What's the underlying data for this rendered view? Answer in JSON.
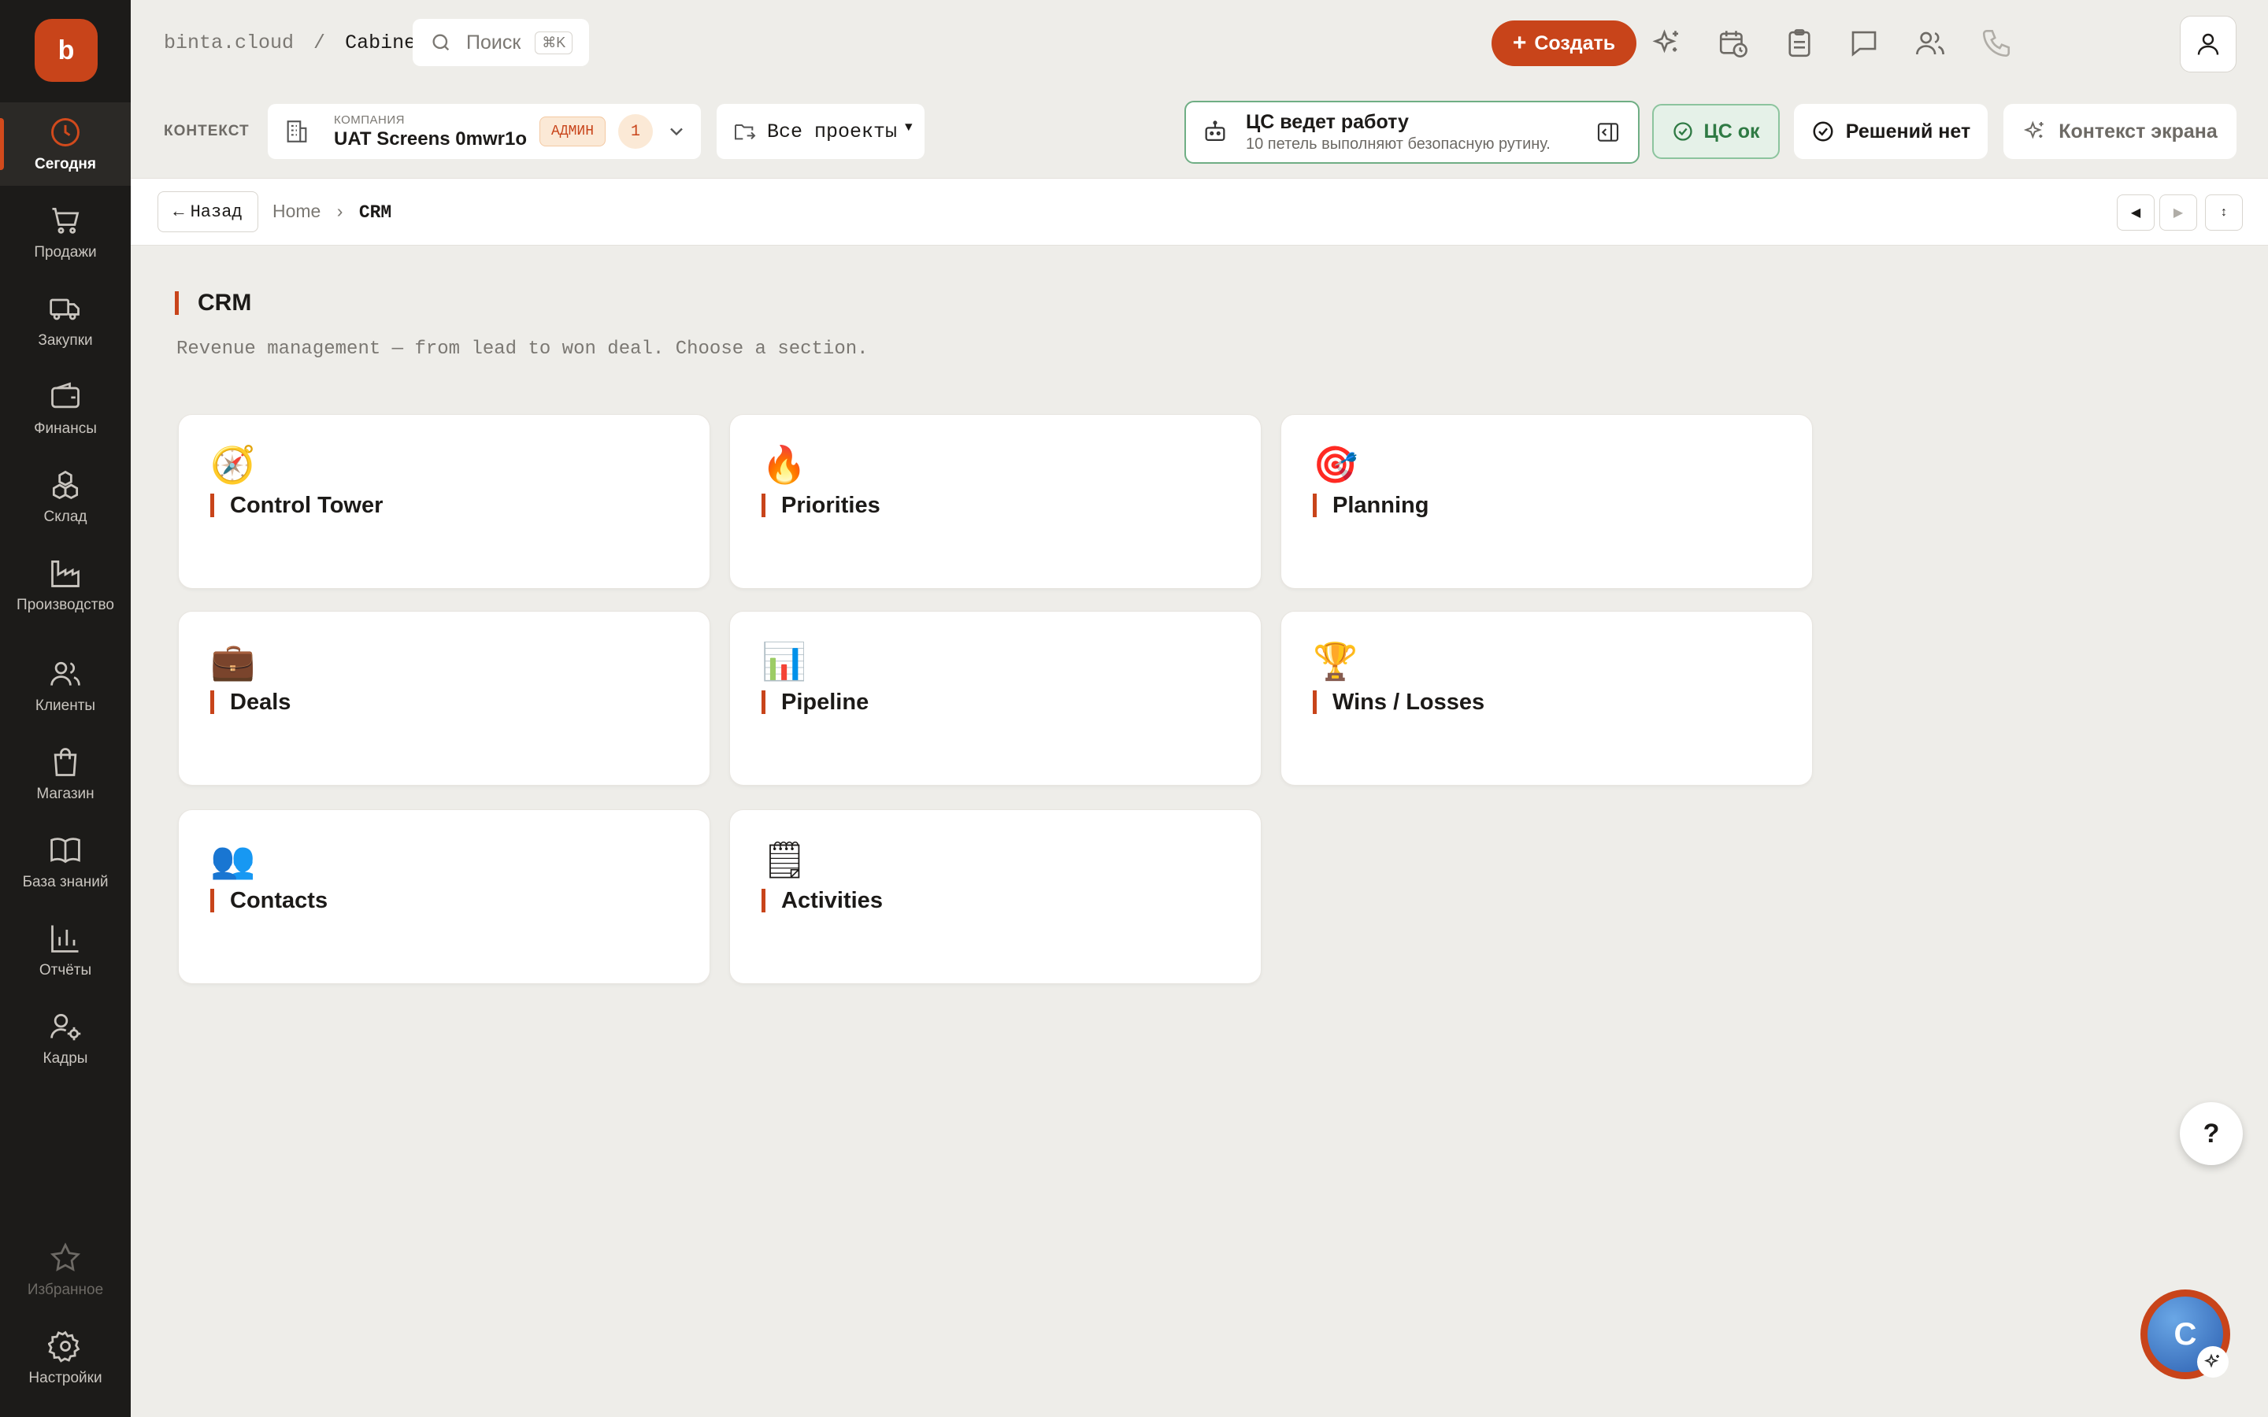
{
  "app": {
    "logo_letter": "b"
  },
  "sidebar": {
    "items": [
      {
        "label": "Сегодня",
        "icon": "clock-icon",
        "active": true
      },
      {
        "label": "Продажи",
        "icon": "cart-icon"
      },
      {
        "label": "Закупки",
        "icon": "truck-icon"
      },
      {
        "label": "Финансы",
        "icon": "wallet-icon"
      },
      {
        "label": "Склад",
        "icon": "boxes-icon"
      },
      {
        "label": "Производство",
        "icon": "factory-icon"
      },
      {
        "label": "Клиенты",
        "icon": "users-icon"
      },
      {
        "label": "Магазин",
        "icon": "shopping-bag-icon"
      },
      {
        "label": "База знаний",
        "icon": "book-icon"
      },
      {
        "label": "Отчёты",
        "icon": "bar-chart-icon"
      },
      {
        "label": "Кадры",
        "icon": "user-gear-icon"
      }
    ],
    "bottom": [
      {
        "label": "Избранное",
        "icon": "star-icon"
      },
      {
        "label": "Настройки",
        "icon": "gear-icon"
      }
    ]
  },
  "topbar": {
    "domain": "binta.cloud",
    "separator": "/",
    "section": "Cabinet",
    "search_placeholder": "Поиск",
    "search_shortcut": "⌘K",
    "create_label": "Создать"
  },
  "context": {
    "label": "КОНТЕКСТ",
    "company_caption": "КОМПАНИЯ",
    "company_name": "UAT Screens 0mwr1o",
    "role_badge": "АДМИН",
    "count_badge": "1",
    "projects_label": "Все проекты",
    "status_title": "ЦС ведет работу",
    "status_subtitle": "10 петель выполняют безопасную рутину.",
    "cs_ok_label": "ЦС ок",
    "decisions_label": "Решений нет",
    "screen_context_label": "Контекст экрана"
  },
  "breadcrumb": {
    "back_label": "Назад",
    "items": [
      "Home",
      "CRM"
    ],
    "separator": "›"
  },
  "main": {
    "title": "CRM",
    "subtitle": "Revenue management — from lead to won deal. Choose a section.",
    "cards": [
      {
        "emoji": "🧭",
        "title": "Control Tower"
      },
      {
        "emoji": "🔥",
        "title": "Priorities"
      },
      {
        "emoji": "🎯",
        "title": "Planning"
      },
      {
        "emoji": "💼",
        "title": "Deals"
      },
      {
        "emoji": "📊",
        "title": "Pipeline"
      },
      {
        "emoji": "🏆",
        "title": "Wins / Losses"
      },
      {
        "emoji": "👥",
        "title": "Contacts"
      },
      {
        "emoji": "🗒",
        "title": "Activities"
      }
    ]
  },
  "floating": {
    "help_label": "?",
    "assistant_letter": "C"
  },
  "colors": {
    "accent": "#c8441a",
    "sidebar_bg": "#1c1b19",
    "page_bg": "#eeede9",
    "ok_green": "#2f7a44"
  }
}
